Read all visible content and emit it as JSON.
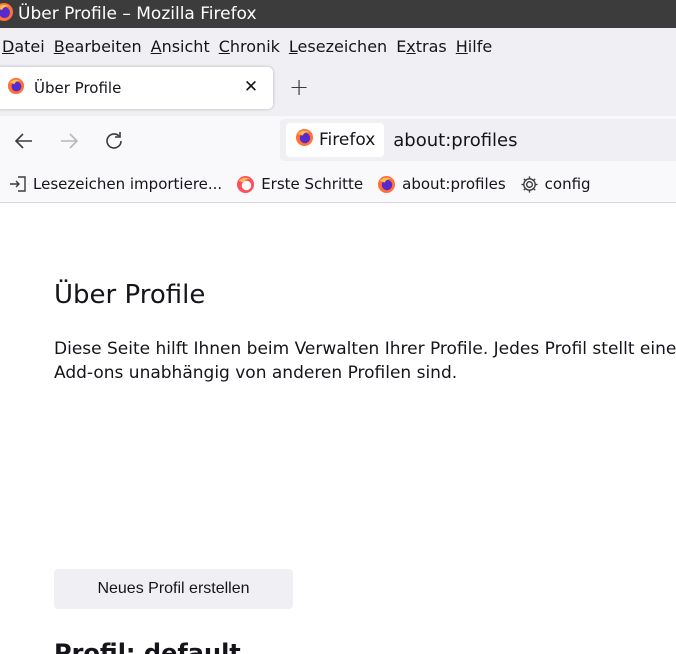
{
  "window": {
    "title": "Über Profile – Mozilla Firefox"
  },
  "menubar": {
    "items": [
      {
        "accel": "D",
        "rest": "atei"
      },
      {
        "accel": "B",
        "rest": "earbeiten"
      },
      {
        "accel": "A",
        "rest": "nsicht"
      },
      {
        "accel": "C",
        "rest": "hronik"
      },
      {
        "accel": "L",
        "rest": "esezeichen"
      },
      {
        "pre": "E",
        "accel": "x",
        "rest": "tras"
      },
      {
        "accel": "H",
        "rest": "ilfe"
      }
    ]
  },
  "tabs": {
    "active_label": "Über Profile",
    "close_glyph": "✕",
    "new_tab_glyph": "+"
  },
  "navbar": {
    "identity_label": "Firefox",
    "url": "about:profiles"
  },
  "bookmarks": {
    "items": [
      {
        "label": "Lesezeichen importiere...",
        "icon": "import-icon"
      },
      {
        "label": "Erste Schritte",
        "icon": "firefox-getting-started-icon"
      },
      {
        "label": "about:profiles",
        "icon": "firefox-icon"
      },
      {
        "label": "config",
        "icon": "gear-icon"
      }
    ]
  },
  "page": {
    "title": "Über Profile",
    "description": "Diese Seite hilft Ihnen beim Verwalten Ihrer Profile. Jedes Profil stellt eine ei Add-ons unabhängig von anderen Profilen sind.",
    "description_line1": "Diese Seite hilft Ihnen beim Verwalten Ihrer Profile. Jedes Profil stellt eine ei",
    "description_line2": "Add-ons unabhängig von anderen Profilen sind.",
    "create_button": "Neues Profil erstellen",
    "profile_heading": "Profil: default"
  },
  "colors": {
    "titlebar_bg": "#3c3c3c",
    "chrome_bg": "#f0f0f4",
    "toolbar_bg": "#f9f9fb",
    "text": "#15141a"
  }
}
